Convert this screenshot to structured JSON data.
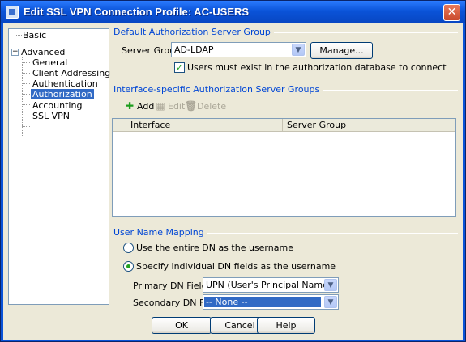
{
  "window": {
    "title": "Edit SSL VPN Connection Profile: AC-USERS",
    "close_label": "✕"
  },
  "tree": {
    "items": [
      {
        "label": "Basic"
      },
      {
        "label": "Advanced",
        "expander": "−"
      },
      {
        "label": "General"
      },
      {
        "label": "Client Addressing"
      },
      {
        "label": "Authentication"
      },
      {
        "label": "Authorization"
      },
      {
        "label": "Accounting"
      },
      {
        "label": "SSL VPN"
      }
    ],
    "selected": "Authorization"
  },
  "default_group": {
    "title": "Default Authorization Server Group",
    "server_group_label": "Server Group:",
    "server_group_value": "AD-LDAP",
    "manage_label": "Manage...",
    "users_must_exist_label": "Users must exist in the authorization database to connect",
    "users_must_exist_checked": true
  },
  "interface_groups": {
    "title": "Interface-specific Authorization Server Groups",
    "add_label": "Add",
    "edit_label": "Edit",
    "delete_label": "Delete",
    "columns": [
      "Interface",
      "Server Group"
    ]
  },
  "user_name_mapping": {
    "title": "User Name Mapping",
    "option_entire_dn": "Use the entire DN as the username",
    "option_individual_dn": "Specify individual DN fields as the username",
    "selected_option": "individual",
    "primary_label": "Primary DN Field:",
    "primary_value": "UPN (User's Principal Name)",
    "secondary_label": "Secondary DN Field:",
    "secondary_value": "-- None --"
  },
  "buttons": {
    "ok": "OK",
    "cancel": "Cancel",
    "help": "Help"
  },
  "colors": {
    "title_bar": "#0a53d8",
    "section_title": "#0046d5",
    "selection": "#316ac5",
    "dialog_bg": "#ece9d8"
  }
}
